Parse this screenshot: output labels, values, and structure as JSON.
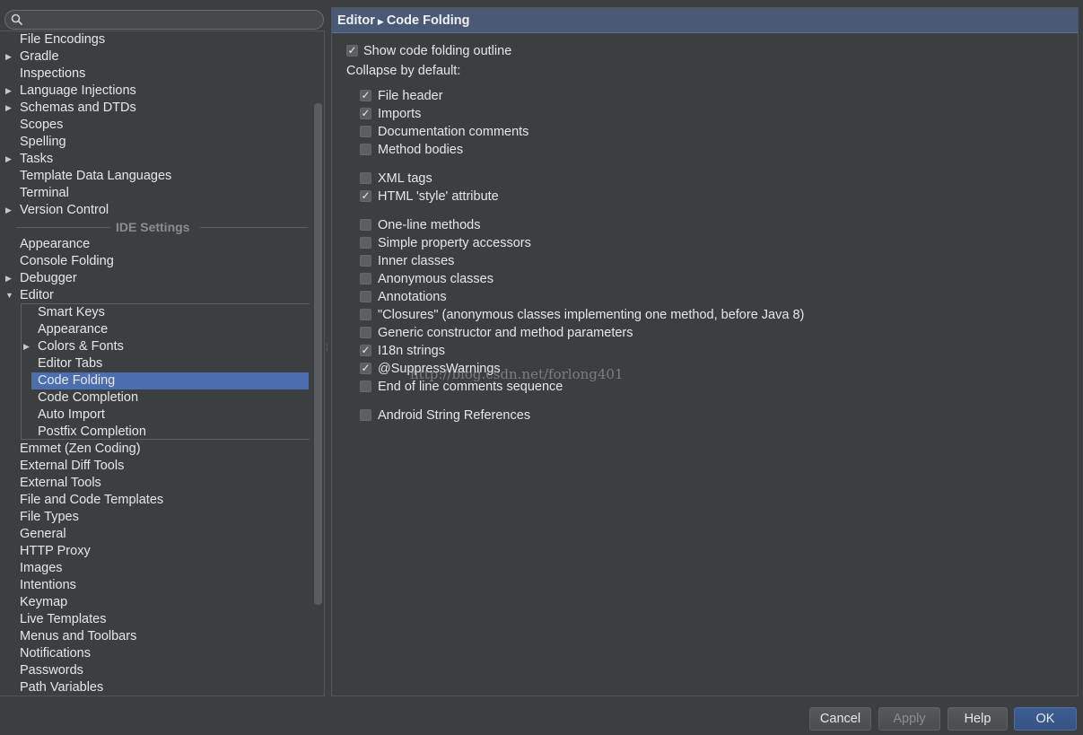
{
  "search": {
    "value": ""
  },
  "tree": {
    "items": [
      {
        "label": "File Encodings",
        "arrow": ""
      },
      {
        "label": "Gradle",
        "arrow": "▶"
      },
      {
        "label": "Inspections",
        "arrow": ""
      },
      {
        "label": "Language Injections",
        "arrow": "▶"
      },
      {
        "label": "Schemas and DTDs",
        "arrow": "▶"
      },
      {
        "label": "Scopes",
        "arrow": ""
      },
      {
        "label": "Spelling",
        "arrow": ""
      },
      {
        "label": "Tasks",
        "arrow": "▶"
      },
      {
        "label": "Template Data Languages",
        "arrow": ""
      },
      {
        "label": "Terminal",
        "arrow": ""
      },
      {
        "label": "Version Control",
        "arrow": "▶"
      }
    ],
    "ide_settings_label": "IDE Settings",
    "ide_items": [
      {
        "label": "Appearance",
        "arrow": ""
      },
      {
        "label": "Console Folding",
        "arrow": ""
      },
      {
        "label": "Debugger",
        "arrow": "▶"
      },
      {
        "label": "Editor",
        "arrow": "▼"
      }
    ],
    "editor_children": [
      {
        "label": "Smart Keys",
        "arrow": ""
      },
      {
        "label": "Appearance",
        "arrow": ""
      },
      {
        "label": "Colors & Fonts",
        "arrow": "▶"
      },
      {
        "label": "Editor Tabs",
        "arrow": ""
      },
      {
        "label": "Code Folding",
        "arrow": "",
        "selected": true
      },
      {
        "label": "Code Completion",
        "arrow": ""
      },
      {
        "label": "Auto Import",
        "arrow": ""
      },
      {
        "label": "Postfix Completion",
        "arrow": ""
      }
    ],
    "after_items": [
      {
        "label": "Emmet (Zen Coding)",
        "arrow": ""
      },
      {
        "label": "External Diff Tools",
        "arrow": ""
      },
      {
        "label": "External Tools",
        "arrow": ""
      },
      {
        "label": "File and Code Templates",
        "arrow": ""
      },
      {
        "label": "File Types",
        "arrow": ""
      },
      {
        "label": "General",
        "arrow": ""
      },
      {
        "label": "HTTP Proxy",
        "arrow": ""
      },
      {
        "label": "Images",
        "arrow": ""
      },
      {
        "label": "Intentions",
        "arrow": ""
      },
      {
        "label": "Keymap",
        "arrow": ""
      },
      {
        "label": "Live Templates",
        "arrow": ""
      },
      {
        "label": "Menus and Toolbars",
        "arrow": ""
      },
      {
        "label": "Notifications",
        "arrow": ""
      },
      {
        "label": "Passwords",
        "arrow": ""
      },
      {
        "label": "Path Variables",
        "arrow": ""
      }
    ]
  },
  "header": {
    "part1": "Editor",
    "separator": "▶",
    "part2": "Code Folding"
  },
  "settings": {
    "show_outline": {
      "label": "Show code folding outline",
      "checked": true
    },
    "collapse_label": "Collapse by default:",
    "groups": [
      [
        {
          "label": "File header",
          "checked": true
        },
        {
          "label": "Imports",
          "checked": true
        },
        {
          "label": "Documentation comments",
          "checked": false
        },
        {
          "label": "Method bodies",
          "checked": false
        }
      ],
      [
        {
          "label": "XML tags",
          "checked": false
        },
        {
          "label": "HTML 'style' attribute",
          "checked": true
        }
      ],
      [
        {
          "label": "One-line methods",
          "checked": false
        },
        {
          "label": "Simple property accessors",
          "checked": false
        },
        {
          "label": "Inner classes",
          "checked": false
        },
        {
          "label": "Anonymous classes",
          "checked": false
        },
        {
          "label": "Annotations",
          "checked": false
        },
        {
          "label": "\"Closures\" (anonymous classes implementing one method, before Java 8)",
          "checked": false
        },
        {
          "label": "Generic constructor and method parameters",
          "checked": false
        },
        {
          "label": "I18n strings",
          "checked": true
        },
        {
          "label": "@SuppressWarnings",
          "checked": true
        },
        {
          "label": "End of line comments sequence",
          "checked": false
        }
      ],
      [
        {
          "label": "Android String References",
          "checked": false
        }
      ]
    ]
  },
  "watermark": "http://blog.csdn.net/forlong401",
  "buttons": {
    "cancel": "Cancel",
    "apply": "Apply",
    "help": "Help",
    "ok": "OK"
  },
  "colors": {
    "selection": "#4b6eaf",
    "header_bg": "#4a5a76",
    "background": "#3c3f41"
  }
}
